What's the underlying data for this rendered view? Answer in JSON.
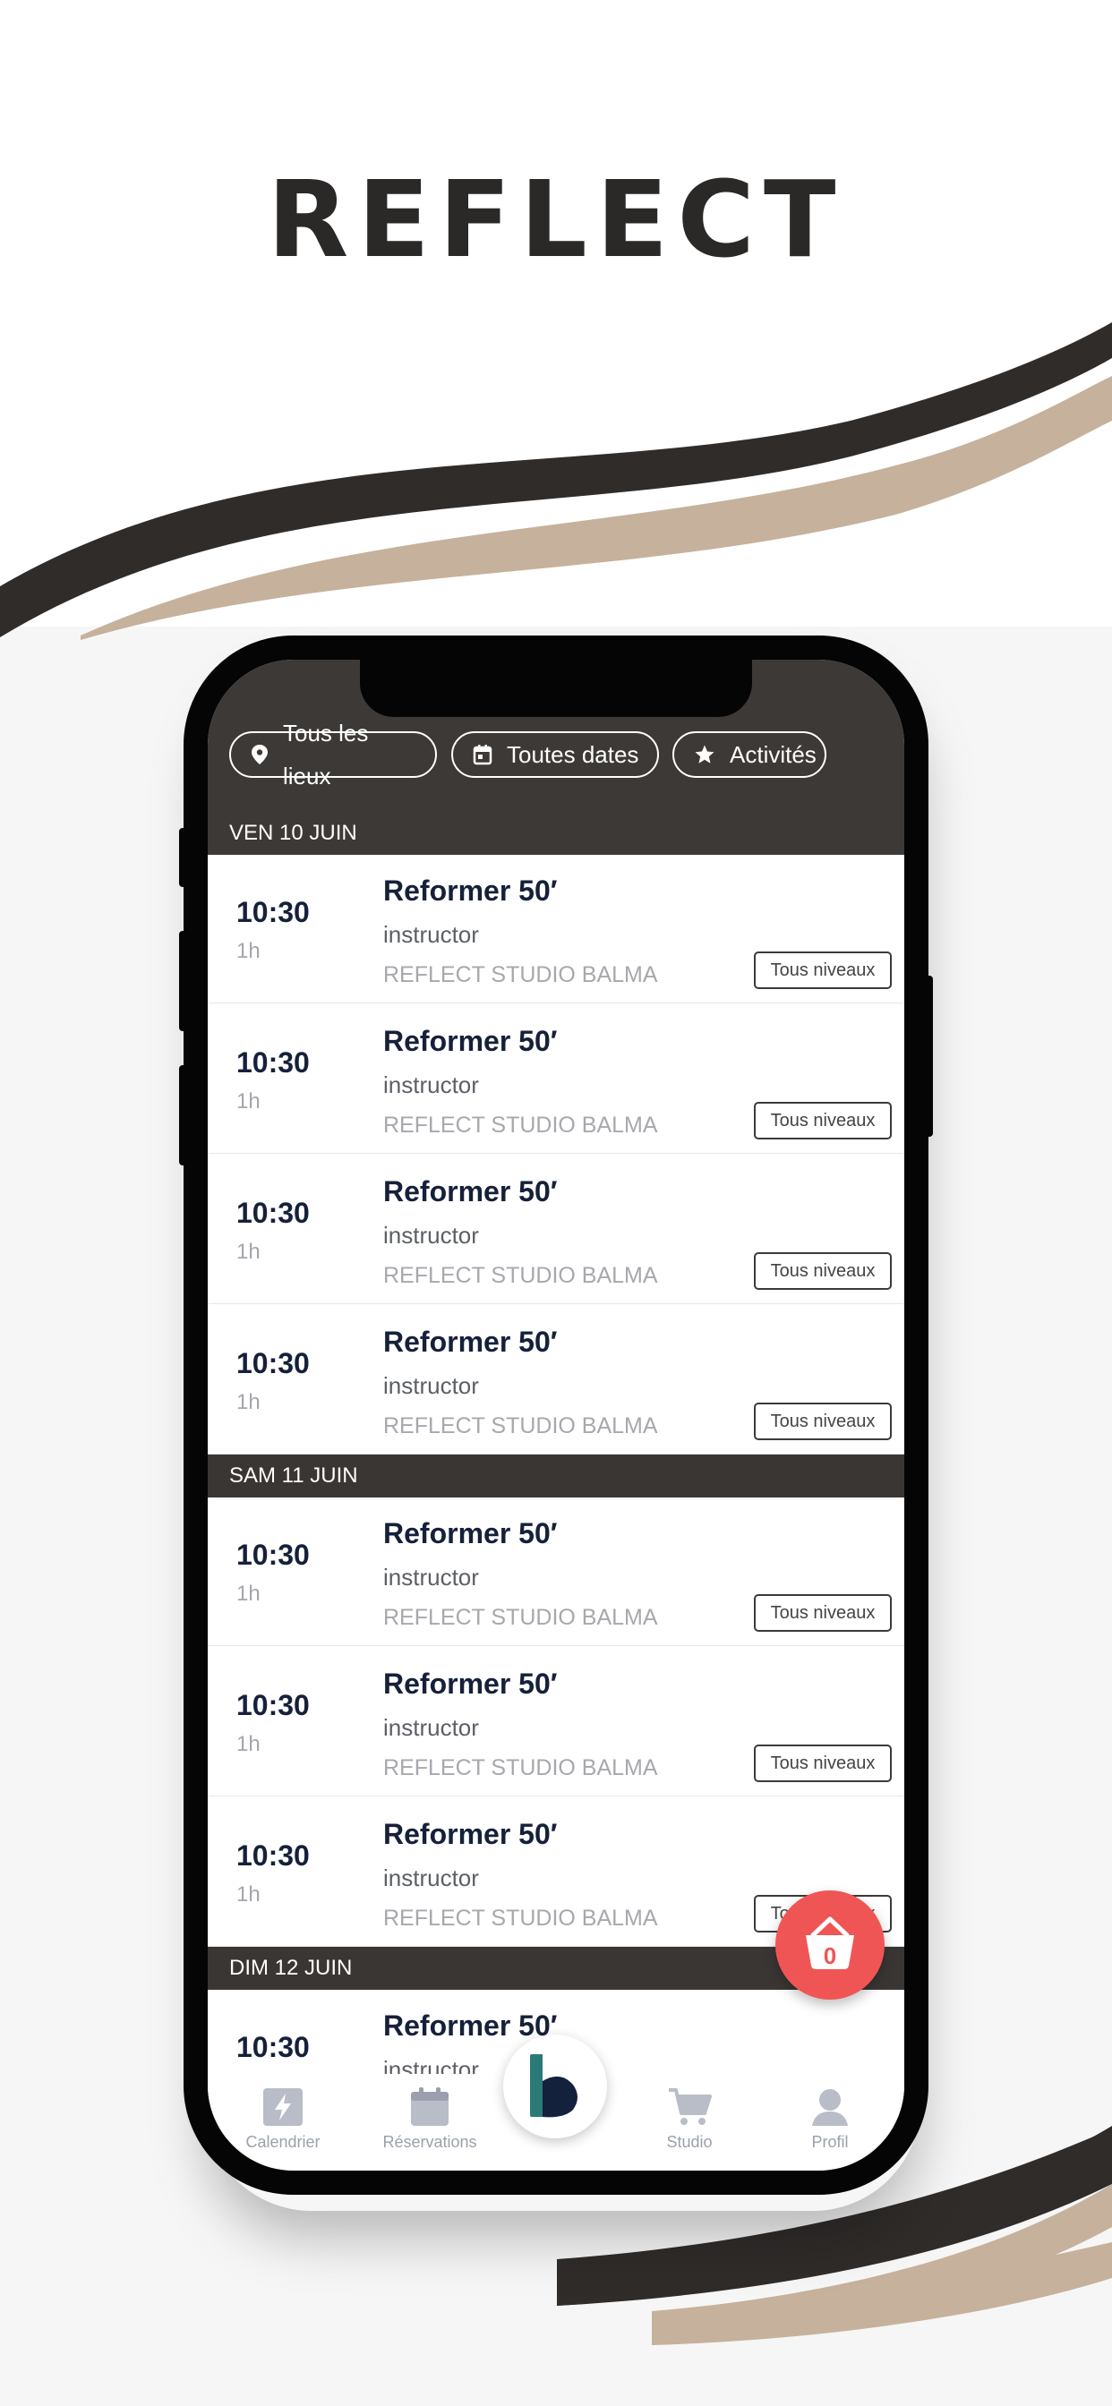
{
  "brand": {
    "logo_text": "REFLECT"
  },
  "filters": [
    {
      "label": "Tous les lieux",
      "icon": "location-pin-icon"
    },
    {
      "label": "Toutes dates",
      "icon": "calendar-icon"
    },
    {
      "label": "Activités",
      "icon": "star-icon"
    }
  ],
  "days": [
    {
      "label": "VEN 10 JUIN",
      "sessions": [
        {
          "time": "10:30",
          "duration": "1h",
          "title": "Reformer 50′",
          "instructor": "instructor",
          "studio": "REFLECT STUDIO BALMA",
          "level": "Tous niveaux"
        },
        {
          "time": "10:30",
          "duration": "1h",
          "title": "Reformer 50′",
          "instructor": "instructor",
          "studio": "REFLECT STUDIO BALMA",
          "level": "Tous niveaux"
        },
        {
          "time": "10:30",
          "duration": "1h",
          "title": "Reformer 50′",
          "instructor": "instructor",
          "studio": "REFLECT STUDIO BALMA",
          "level": "Tous niveaux"
        },
        {
          "time": "10:30",
          "duration": "1h",
          "title": "Reformer 50′",
          "instructor": "instructor",
          "studio": "REFLECT STUDIO BALMA",
          "level": "Tous niveaux"
        }
      ]
    },
    {
      "label": "SAM 11 JUIN",
      "sessions": [
        {
          "time": "10:30",
          "duration": "1h",
          "title": "Reformer 50′",
          "instructor": "instructor",
          "studio": "REFLECT STUDIO BALMA",
          "level": "Tous niveaux"
        },
        {
          "time": "10:30",
          "duration": "1h",
          "title": "Reformer 50′",
          "instructor": "instructor",
          "studio": "REFLECT STUDIO BALMA",
          "level": "Tous niveaux"
        },
        {
          "time": "10:30",
          "duration": "1h",
          "title": "Reformer 50′",
          "instructor": "instructor",
          "studio": "REFLECT STUDIO BALMA",
          "level": "Tous niveaux"
        }
      ]
    },
    {
      "label": "DIM 12 JUIN",
      "sessions": [
        {
          "time": "10:30",
          "title": "Reformer 50′",
          "instructor": "instructor"
        }
      ]
    }
  ],
  "cart": {
    "count": "0",
    "icon": "basket-icon"
  },
  "tabbar": {
    "items": [
      {
        "label": "Calendrier",
        "icon": "lightning-calendar-icon"
      },
      {
        "label": "Réservations",
        "icon": "calendar-icon"
      },
      {
        "label": "",
        "icon": "brand-b-icon"
      },
      {
        "label": "Studio",
        "icon": "cart-icon"
      },
      {
        "label": "Profil",
        "icon": "user-icon"
      }
    ]
  },
  "colors": {
    "header_bg": "#3d3936",
    "swoosh_dark": "#2f2c2a",
    "swoosh_tan": "#c6b19c",
    "fab": "#f05556",
    "title_text": "#16203a",
    "tab_icon": "#9aa0ad"
  }
}
